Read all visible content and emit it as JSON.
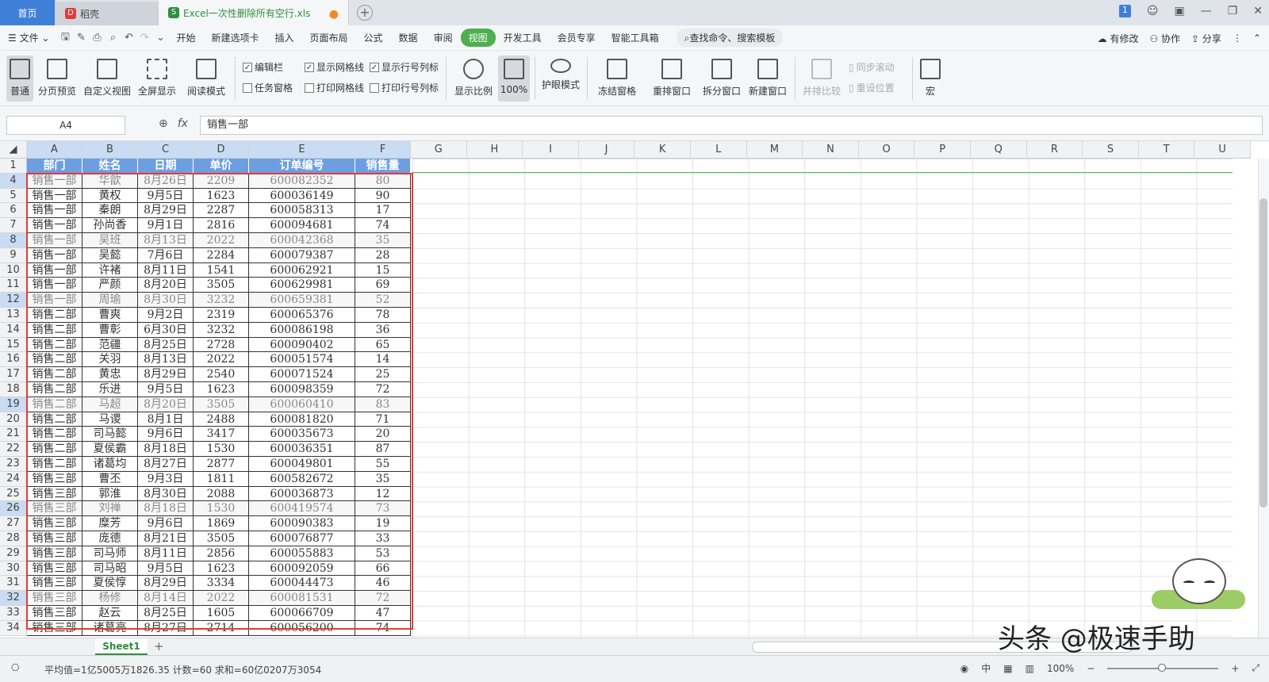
{
  "tabs": {
    "home": "首页",
    "daoke": "稻壳",
    "file": "Excel一次性删除所有空行.xls",
    "file_badge": "S",
    "daoke_badge": "D",
    "notify": "1"
  },
  "menu": {
    "file": "文件",
    "items": [
      "开始",
      "新建选项卡",
      "插入",
      "页面布局",
      "公式",
      "数据",
      "审阅",
      "视图",
      "开发工具",
      "会员专享",
      "智能工具箱"
    ],
    "active_index": 7,
    "search": "查找命令、搜索模板",
    "modified": "有修改",
    "collab": "协作",
    "share": "分享"
  },
  "ribbon": {
    "big_buttons": [
      "普通",
      "分页预览",
      "自定义视图",
      "全屏显示",
      "阅读模式",
      "显示比例",
      "100%",
      "护眼模式",
      "冻结窗格",
      "重排窗口",
      "拆分窗口",
      "新建窗口",
      "并排比较",
      "宏"
    ],
    "checks": [
      {
        "label": "编辑栏",
        "checked": true
      },
      {
        "label": "显示网格线",
        "checked": true
      },
      {
        "label": "显示行号列标",
        "checked": true
      },
      {
        "label": "任务窗格",
        "checked": false
      },
      {
        "label": "打印网格线",
        "checked": false
      },
      {
        "label": "打印行号列标",
        "checked": false
      }
    ],
    "sync_scroll": "同步滚动",
    "reset_pos": "重设位置"
  },
  "formula": {
    "cell_ref": "A4",
    "value": "销售一部",
    "fx": "fx"
  },
  "columns": [
    "A",
    "B",
    "C",
    "D",
    "E",
    "F",
    "G",
    "H",
    "I",
    "J",
    "K",
    "L",
    "M",
    "N",
    "O",
    "P",
    "Q",
    "R",
    "S",
    "T",
    "U"
  ],
  "header_row": {
    "num": "1",
    "cells": [
      "部门",
      "姓名",
      "日期",
      "单价",
      "订单编号",
      "销售量"
    ]
  },
  "rows": [
    {
      "num": "4",
      "gray": true,
      "cells": [
        "销售一部",
        "华歆",
        "8月26日",
        "2209",
        "600082352",
        "80"
      ]
    },
    {
      "num": "5",
      "gray": false,
      "cells": [
        "销售一部",
        "黄权",
        "9月5日",
        "1623",
        "600036149",
        "90"
      ]
    },
    {
      "num": "6",
      "gray": false,
      "cells": [
        "销售一部",
        "秦朗",
        "8月29日",
        "2287",
        "600058313",
        "17"
      ]
    },
    {
      "num": "7",
      "gray": false,
      "cells": [
        "销售一部",
        "孙尚香",
        "9月1日",
        "2816",
        "600094681",
        "74"
      ]
    },
    {
      "num": "8",
      "gray": true,
      "cells": [
        "销售一部",
        "吴班",
        "8月13日",
        "2022",
        "600042368",
        "35"
      ]
    },
    {
      "num": "9",
      "gray": false,
      "cells": [
        "销售一部",
        "吴懿",
        "7月6日",
        "2284",
        "600079387",
        "28"
      ]
    },
    {
      "num": "10",
      "gray": false,
      "cells": [
        "销售一部",
        "许褚",
        "8月11日",
        "1541",
        "600062921",
        "15"
      ]
    },
    {
      "num": "11",
      "gray": false,
      "cells": [
        "销售一部",
        "严颜",
        "8月20日",
        "3505",
        "600629981",
        "69"
      ]
    },
    {
      "num": "12",
      "gray": true,
      "cells": [
        "销售一部",
        "周瑜",
        "8月30日",
        "3232",
        "600659381",
        "52"
      ]
    },
    {
      "num": "13",
      "gray": false,
      "cells": [
        "销售二部",
        "曹爽",
        "9月2日",
        "2319",
        "600065376",
        "78"
      ]
    },
    {
      "num": "14",
      "gray": false,
      "cells": [
        "销售二部",
        "曹彰",
        "6月30日",
        "3232",
        "600086198",
        "36"
      ]
    },
    {
      "num": "15",
      "gray": false,
      "cells": [
        "销售二部",
        "范疆",
        "8月25日",
        "2728",
        "600090402",
        "65"
      ]
    },
    {
      "num": "16",
      "gray": false,
      "cells": [
        "销售二部",
        "关羽",
        "8月13日",
        "2022",
        "600051574",
        "14"
      ]
    },
    {
      "num": "17",
      "gray": false,
      "cells": [
        "销售二部",
        "黄忠",
        "8月29日",
        "2540",
        "600071524",
        "25"
      ]
    },
    {
      "num": "18",
      "gray": false,
      "cells": [
        "销售二部",
        "乐进",
        "9月5日",
        "1623",
        "600098359",
        "72"
      ]
    },
    {
      "num": "19",
      "gray": true,
      "cells": [
        "销售二部",
        "马超",
        "8月20日",
        "3505",
        "600060410",
        "83"
      ]
    },
    {
      "num": "20",
      "gray": false,
      "cells": [
        "销售二部",
        "马谡",
        "8月1日",
        "2488",
        "600081820",
        "71"
      ]
    },
    {
      "num": "21",
      "gray": false,
      "cells": [
        "销售二部",
        "司马懿",
        "9月6日",
        "3417",
        "600035673",
        "20"
      ]
    },
    {
      "num": "22",
      "gray": false,
      "cells": [
        "销售二部",
        "夏侯霸",
        "8月18日",
        "1530",
        "600036351",
        "87"
      ]
    },
    {
      "num": "23",
      "gray": false,
      "cells": [
        "销售二部",
        "诸葛均",
        "8月27日",
        "2877",
        "600049801",
        "55"
      ]
    },
    {
      "num": "24",
      "gray": false,
      "cells": [
        "销售三部",
        "曹丕",
        "9月3日",
        "1811",
        "600582672",
        "35"
      ]
    },
    {
      "num": "25",
      "gray": false,
      "cells": [
        "销售三部",
        "郭淮",
        "8月30日",
        "2088",
        "600036873",
        "12"
      ]
    },
    {
      "num": "26",
      "gray": true,
      "cells": [
        "销售三部",
        "刘禅",
        "8月18日",
        "1530",
        "600419574",
        "73"
      ]
    },
    {
      "num": "27",
      "gray": false,
      "cells": [
        "销售三部",
        "糜芳",
        "9月6日",
        "1869",
        "600090383",
        "19"
      ]
    },
    {
      "num": "28",
      "gray": false,
      "cells": [
        "销售三部",
        "庞德",
        "8月21日",
        "3505",
        "600076877",
        "33"
      ]
    },
    {
      "num": "29",
      "gray": false,
      "cells": [
        "销售三部",
        "司马师",
        "8月11日",
        "2856",
        "600055883",
        "53"
      ]
    },
    {
      "num": "30",
      "gray": false,
      "cells": [
        "销售三部",
        "司马昭",
        "9月5日",
        "1623",
        "600092059",
        "66"
      ]
    },
    {
      "num": "31",
      "gray": false,
      "cells": [
        "销售三部",
        "夏侯惇",
        "8月29日",
        "3334",
        "600044473",
        "46"
      ]
    },
    {
      "num": "32",
      "gray": true,
      "cells": [
        "销售三部",
        "杨修",
        "8月14日",
        "2022",
        "600081531",
        "72"
      ]
    },
    {
      "num": "33",
      "gray": false,
      "cells": [
        "销售三部",
        "赵云",
        "8月25日",
        "1605",
        "600066709",
        "47"
      ]
    },
    {
      "num": "34",
      "gray": false,
      "cells": [
        "销售三部",
        "诸葛亮",
        "8月27日",
        "2714",
        "600056200",
        "74"
      ]
    }
  ],
  "sheet": {
    "name": "Sheet1"
  },
  "status": {
    "summary": "平均值=1亿5005万1826.35  计数=60  求和=60亿0207万3054",
    "lang": "中",
    "zoom": "100%"
  },
  "watermark": "头条 @极速手助",
  "colors": {
    "accent": "#4caf50",
    "header_fill": "#6d9fe0",
    "highlight_border": "#e53935"
  }
}
